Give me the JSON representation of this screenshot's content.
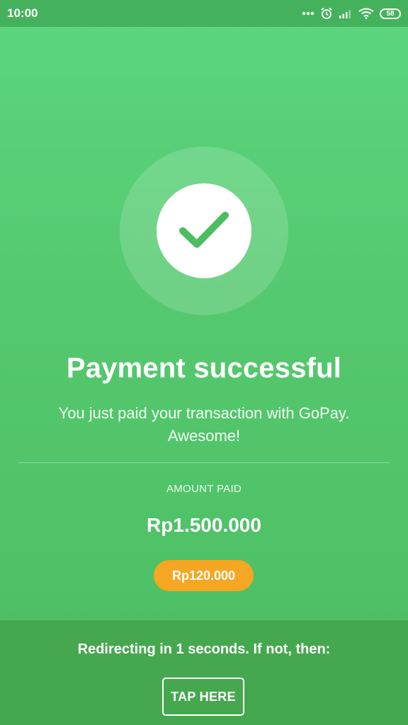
{
  "status_bar": {
    "time": "10:00",
    "battery": "58",
    "icons": [
      "more-dots-icon",
      "alarm-icon",
      "signal-icon",
      "wifi-icon",
      "battery-icon"
    ]
  },
  "colors": {
    "background": "#55c96f",
    "status_bar": "#44b25c",
    "bottom_panel": "#45a84e",
    "accent_pill": "#f5a623",
    "check": "#4cbd61"
  },
  "main": {
    "icon": "check-icon",
    "title": "Payment successful",
    "subtitle_line1": "You just paid your transaction with GoPay.",
    "subtitle_line2": "Awesome!",
    "amount_label": "AMOUNT PAID",
    "amount_value": "Rp1.500.000",
    "pill_value": "Rp120.000"
  },
  "footer": {
    "redirect_text": "Redirecting in 1 seconds. If not, then:",
    "button_label": "TAP HERE"
  }
}
